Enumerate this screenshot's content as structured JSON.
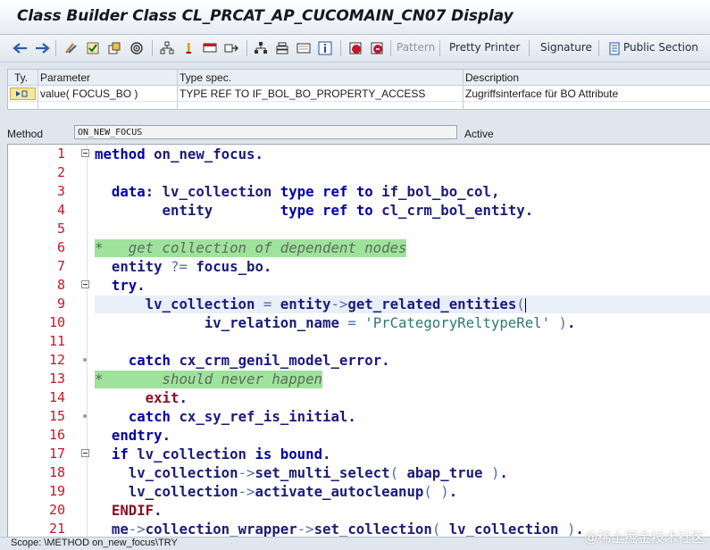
{
  "window": {
    "title": "Class Builder Class CL_PRCAT_AP_CUCOMAIN_CN07 Display"
  },
  "toolbar": {
    "icons": [
      "back-arrow-icon",
      "forward-arrow-icon",
      "toggle-edit-icon",
      "check-icon",
      "activate-icon",
      "test-icon",
      "where-used-icon",
      "breakpoint-icon",
      "display-object-list-icon",
      "navigation-window-icon",
      "hierarchy-icon",
      "stack-icon",
      "help-icon",
      "info-icon",
      "insert-statement-icon",
      "stop-icon"
    ],
    "pattern_label": "Pattern",
    "pretty_printer_label": "Pretty Printer",
    "signature_label": "Signature",
    "public_section_label": "Public Section"
  },
  "params": {
    "headers": {
      "ty": "Ty.",
      "parameter": "Parameter",
      "type_spec": "Type spec.",
      "description": "Description"
    },
    "rows": [
      {
        "ty_icon": "importing-parameter-icon",
        "parameter": "value( FOCUS_BO )",
        "type_spec": "TYPE REF TO IF_BOL_BO_PROPERTY_ACCESS",
        "description": "Zugriffsinterface für BO Attribute"
      }
    ]
  },
  "method": {
    "label": "Method",
    "name": "ON_NEW_FOCUS",
    "status": "Active"
  },
  "editor": {
    "lines": [
      {
        "n": "1",
        "text": "method on_new_focus."
      },
      {
        "n": "2",
        "text": ""
      },
      {
        "n": "3",
        "text": "  data: lv_collection type ref to if_bol_bo_col,"
      },
      {
        "n": "4",
        "text": "        entity        type ref to cl_crm_bol_entity."
      },
      {
        "n": "5",
        "text": ""
      },
      {
        "n": "6",
        "text": "*   get collection of dependent nodes"
      },
      {
        "n": "7",
        "text": "  entity ?= focus_bo."
      },
      {
        "n": "8",
        "text": "  try."
      },
      {
        "n": "9",
        "text": "      lv_collection = entity->get_related_entities("
      },
      {
        "n": "10",
        "text": "             iv_relation_name = 'PrCategoryReltypeRel' )."
      },
      {
        "n": "11",
        "text": ""
      },
      {
        "n": "12",
        "text": "    catch cx_crm_genil_model_error."
      },
      {
        "n": "13",
        "text": "*       should never happen"
      },
      {
        "n": "14",
        "text": "      exit."
      },
      {
        "n": "15",
        "text": "    catch cx_sy_ref_is_initial."
      },
      {
        "n": "16",
        "text": "  endtry."
      },
      {
        "n": "17",
        "text": "  if lv_collection is bound."
      },
      {
        "n": "18",
        "text": "    lv_collection->set_multi_select( abap_true )."
      },
      {
        "n": "19",
        "text": "    lv_collection->activate_autocleanup( )."
      },
      {
        "n": "20",
        "text": "  ENDIF."
      },
      {
        "n": "21",
        "text": "  me->collection_wrapper->set_collection( lv_collection )."
      }
    ]
  },
  "statusbar": {
    "scope": "Scope: \\METHOD on_new_focus\\TRY"
  },
  "watermark": "@稀土掘金技术社区"
}
